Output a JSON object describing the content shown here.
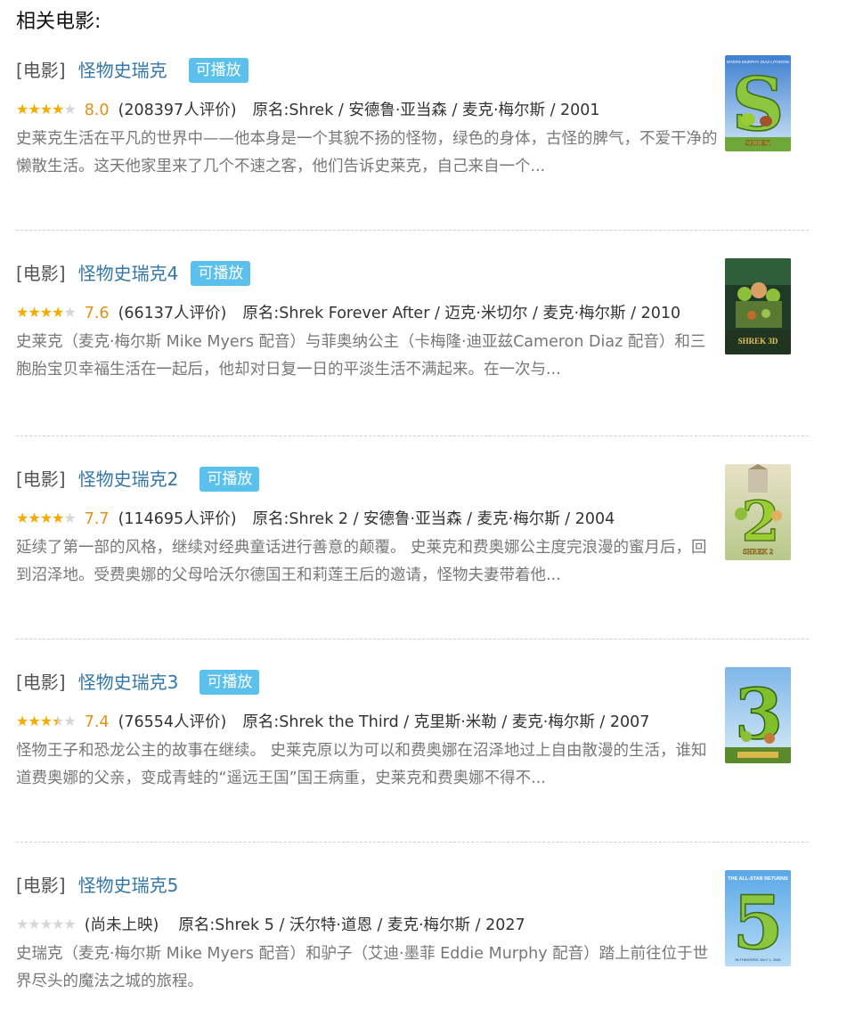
{
  "section_title": "相关电影:",
  "items": [
    {
      "category": "[电影]",
      "title": "怪物史瑞克",
      "badge": "可播放",
      "rating": 8.0,
      "score_text": "8.0",
      "votes": "(208397人评价)",
      "original": "原名:Shrek / 安德鲁·亚当森 / 麦克·梅尔斯 / 2001",
      "description": "史莱克生活在平凡的世界中——他本身是一个其貌不扬的怪物，绿色的身体，古怪的脾气，不爱干净的懒散生活。这天他家里来了几个不速之客，他们告诉史莱克，自己来自一个...",
      "poster": {
        "top": "MYERS MURPHY DIAZ LITHGOW",
        "big": "S",
        "bottom": "SHREK"
      },
      "stars": [
        "full",
        "full",
        "full",
        "full",
        "empty"
      ]
    },
    {
      "category": "[电影]",
      "title": "怪物史瑞克4",
      "badge": "可播放",
      "rating": 7.6,
      "score_text": "7.6",
      "votes": "(66137人评价)",
      "original": "原名:Shrek Forever After / 迈克·米切尔 / 麦克·梅尔斯 / 2010",
      "description": "史莱克（麦克·梅尔斯 Mike Myers 配音）与菲奥纳公主（卡梅隆·迪亚兹Cameron Diaz 配音）和三胞胎宝贝幸福生活在一起后，他却对日复一日的平淡生活不满起来。在一次与...",
      "poster": {
        "top": "",
        "big": "",
        "bottom": "SHREK 3D"
      },
      "stars": [
        "full",
        "full",
        "full",
        "full",
        "empty"
      ]
    },
    {
      "category": "[电影]",
      "title": "怪物史瑞克2",
      "badge": "可播放",
      "rating": 7.7,
      "score_text": "7.7",
      "votes": "(114695人评价)",
      "original": "原名:Shrek 2 / 安德鲁·亚当森 / 麦克·梅尔斯 / 2004",
      "description": "延续了第一部的风格，继续对经典童话进行善意的颠覆。 史莱克和费奥娜公主度完浪漫的蜜月后，回到沼泽地。受费奥娜的父母哈沃尔德国王和莉莲王后的邀请，怪物夫妻带着他...",
      "poster": {
        "top": "",
        "big": "2",
        "bottom": "SHREK 2"
      },
      "stars": [
        "full",
        "full",
        "full",
        "full",
        "empty"
      ]
    },
    {
      "category": "[电影]",
      "title": "怪物史瑞克3",
      "badge": "可播放",
      "rating": 7.4,
      "score_text": "7.4",
      "votes": "(76554人评价)",
      "original": "原名:Shrek the Third / 克里斯·米勒 / 麦克·梅尔斯 / 2007",
      "description": "怪物王子和恐龙公主的故事在继续。 史莱克原以为可以和费奥娜在沼泽地过上自由散漫的生活，谁知道费奥娜的父亲，变成青蛙的“遥远王国”国王病重，史莱克和费奥娜不得不...",
      "poster": {
        "top": "",
        "big": "3",
        "bottom": ""
      },
      "stars": [
        "full",
        "full",
        "full",
        "half",
        "empty"
      ]
    },
    {
      "category": "[电影]",
      "title": "怪物史瑞克5",
      "badge": "",
      "rating": null,
      "score_text": "",
      "votes": "(尚未上映)",
      "original": "原名:Shrek 5 / 沃尔特·道恩 / 麦克·梅尔斯 / 2027",
      "description": "史瑞克（麦克·梅尔斯 Mike Myers 配音）和驴子（艾迪·墨菲 Eddie Murphy 配音）踏上前往位于世界尽头的魔法之城的旅程。",
      "poster": {
        "top": "THE ALL-STAR RETURNS",
        "big": "5",
        "bottom": "IN THEATERS JULY 1, 2026"
      },
      "stars": [
        "empty",
        "empty",
        "empty",
        "empty",
        "empty"
      ]
    }
  ]
}
